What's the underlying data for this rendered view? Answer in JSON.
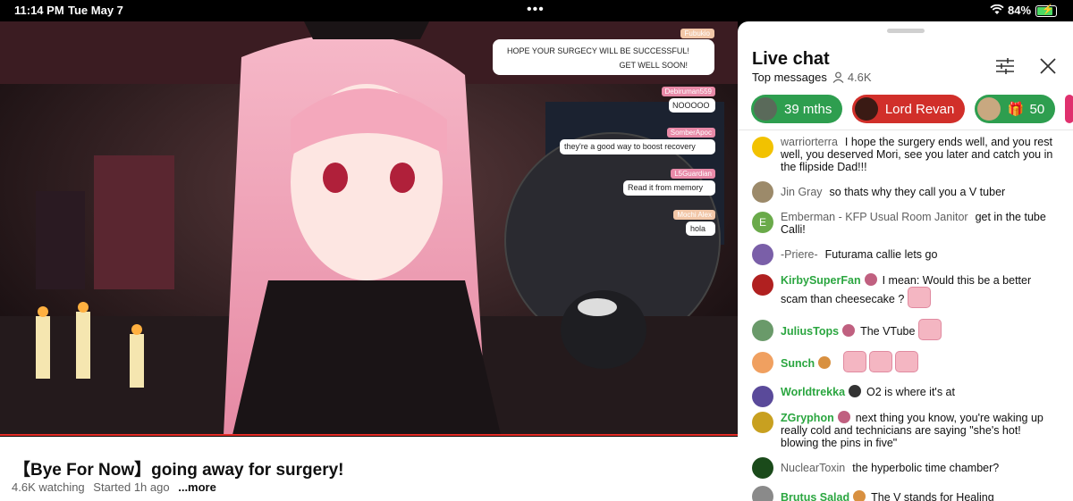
{
  "status": {
    "time": "11:14 PM",
    "date": "Tue May 7",
    "battery": "84%"
  },
  "video": {
    "overlay_chat": [
      {
        "user": "Fubukio",
        "text": "HOPE YOUR SURGECY WILL BE SUCCESSFUL!",
        "text2": "GET WELL SOON!"
      },
      {
        "user": "Debiruman559",
        "text": "NOOOOO"
      },
      {
        "user": "SomberApoc",
        "text": "they're a good way to boost recovery"
      },
      {
        "user": "L5Guardian",
        "text": "Read it from memory"
      },
      {
        "user": "Mochi Alex",
        "text": "hola"
      }
    ]
  },
  "info": {
    "title": "【Bye For Now】going away for surgery!",
    "watching": "4.6K watching",
    "started": "Started 1h ago",
    "more": "...more"
  },
  "chat": {
    "title": "Live chat",
    "mode": "Top messages",
    "viewers": "4.6K",
    "chips": [
      {
        "label": "39 mths",
        "color": "#2e9e4f"
      },
      {
        "label": "Lord Revan",
        "color": "#d12f2a"
      },
      {
        "label": "50",
        "color": "#2e9e4f"
      }
    ],
    "messages": [
      {
        "author": "warriorterra",
        "text": "I hope the surgery ends well, and you rest well, you deserved Mori, see you later and catch you in the flipside Dad!!!",
        "member": false,
        "avatar": "#f2c200"
      },
      {
        "author": "Jin Gray",
        "text": "so thats why they call you a V tuber",
        "member": false,
        "avatar": "#9c8a6a"
      },
      {
        "author": "Emberman - KFP Usual Room Janitor",
        "text": "get in the tube Calli!",
        "member": false,
        "avatar": "#6aaa4a",
        "initial": "E"
      },
      {
        "author": "-Priere-",
        "text": "Futurama callie lets go",
        "member": false,
        "avatar": "#7a5fa8"
      },
      {
        "author": "KirbySuperFan",
        "text": "I mean: Would this be a better scam than cheesecake ?",
        "member": true,
        "avatar": "#b02020"
      },
      {
        "author": "JuliusTops",
        "text": "The VTube",
        "member": true,
        "avatar": "#6a9a6a"
      },
      {
        "author": "Sunch",
        "text": "",
        "member": true,
        "avatar": "#f0a060"
      },
      {
        "author": "Worldtrekka",
        "text": "O2 is where it's at",
        "member": true,
        "avatar": "#5a4a9a"
      },
      {
        "author": "ZGryphon",
        "text": "next thing you know, you're waking up really cold and technicians are saying \"she's hot! blowing the pins in five\"",
        "member": true,
        "avatar": "#c8a020"
      },
      {
        "author": "NuclearToxin",
        "text": "the hyperbolic time chamber?",
        "member": false,
        "avatar": "#1a4a1a"
      },
      {
        "author": "Brutus Salad",
        "text": "The V stands for Healing",
        "member": true,
        "avatar": "#8a8a8a"
      }
    ]
  }
}
